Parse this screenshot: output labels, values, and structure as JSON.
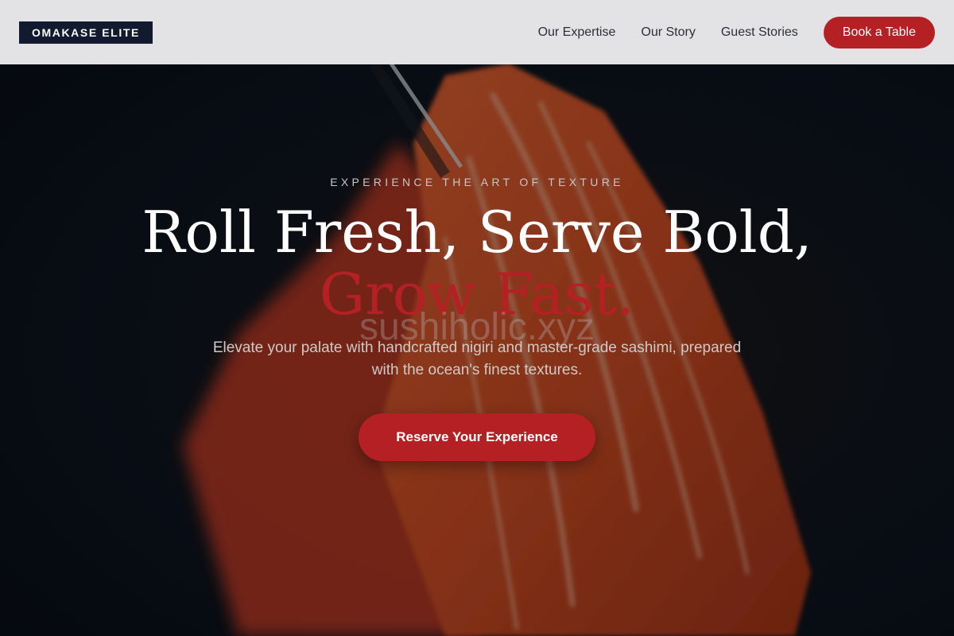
{
  "brand": {
    "logo_text": "OMAKASE ELITE"
  },
  "nav": {
    "links": [
      "Our Expertise",
      "Our Story",
      "Guest Stories"
    ],
    "cta_label": "Book a Table"
  },
  "hero": {
    "eyebrow": "EXPERIENCE THE ART OF TEXTURE",
    "headline_line1": "Roll Fresh, Serve Bold,",
    "headline_line2": "Grow Fast.",
    "watermark": "sushiholic.xyz",
    "subtitle": "Elevate your palate with handcrafted nigiri and master-grade sashimi, prepared with the ocean's finest textures.",
    "cta_label": "Reserve Your Experience",
    "background_image": "salmon-sashimi-photo"
  },
  "colors": {
    "accent": "#b52025",
    "logo_bg": "#111a2e",
    "nav_bg": "#ececee",
    "hero_bg": "#070c14"
  }
}
